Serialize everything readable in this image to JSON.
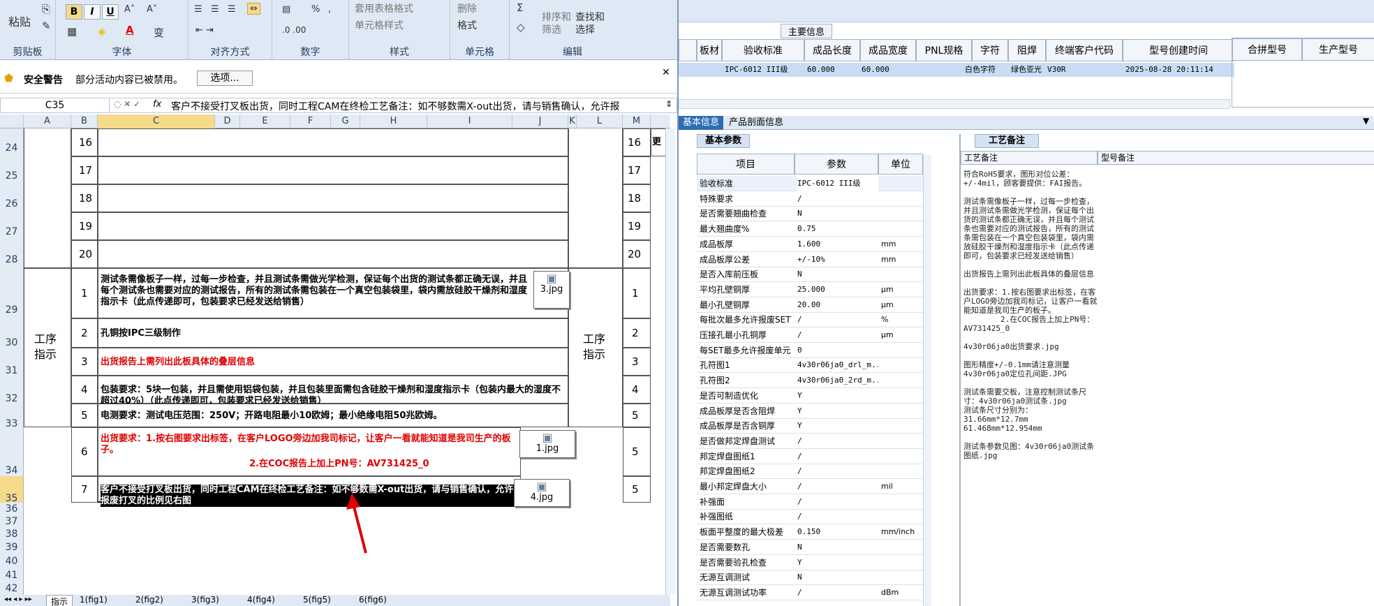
{
  "ribbon": {
    "paste": "粘贴",
    "clipboard": "剪贴板",
    "font": "字体",
    "alignment": "对齐方式",
    "number": "数字",
    "styles": "样式",
    "cells": "单元格",
    "editing": "编辑",
    "table_format": "套用表格格式",
    "cell_styles": "单元格样式",
    "delete": "删除",
    "format": "格式",
    "sort_filter": "排序和\n筛选",
    "find_select": "查找和\n选择",
    "bold": "B",
    "italic": "I",
    "underline": "U"
  },
  "alert": {
    "title": "安全警告",
    "message": "部分活动内容已被禁用。",
    "options_btn": "选项..."
  },
  "formula_bar": {
    "cell_ref": "C35",
    "fx": "fx",
    "content": "客户不接受打叉板出货，同时工程CAM在终检工艺备注：如不够数需X-out出货，请与销售确认，允许报"
  },
  "columns": [
    "A",
    "B",
    "C",
    "D",
    "E",
    "F",
    "G",
    "H",
    "I",
    "J",
    "K",
    "L",
    "M"
  ],
  "rows": [
    "24",
    "25",
    "26",
    "27",
    "28",
    "29",
    "30",
    "31",
    "32",
    "33",
    "34",
    "35",
    "36",
    "37",
    "38",
    "39",
    "40",
    "41",
    "42"
  ],
  "sheet": {
    "section_label": "工序\n指示",
    "num_rows": [
      "16",
      "17",
      "18",
      "19",
      "20"
    ],
    "right_truncated": "更",
    "steps": [
      {
        "n": "1",
        "text": "测试条需像板子一样，过每一步检查，并且测试条需做光学检测，保证每个出货的测试条都正确无误，并且每个测试条也需要对应的测试报告，所有的测试条需包装在一个真空包装袋里，袋内需放硅胶干燥剂和湿度指示卡（此点传递即可，包装要求已经发送给销售）",
        "red": false,
        "img": "3.jpg",
        "right": "1"
      },
      {
        "n": "2",
        "text": "孔铜按IPC三级制作",
        "red": false,
        "img": "",
        "right": "2"
      },
      {
        "n": "3",
        "text": "出货报告上需列出此板具体的叠层信息",
        "red": true,
        "img": "",
        "right": "3"
      },
      {
        "n": "4",
        "text": "包装要求：5块一包装，并且需使用铝袋包装，并且包装里面需包含硅胶干燥剂和湿度指示卡（包装内最大的湿度不超过40%）（此点传递即可，包装要求已经发送给销售）",
        "red": false,
        "img": "",
        "right": "4"
      },
      {
        "n": "5",
        "text": "电测要求：测试电压范围：250V；开路电阻最小10欧姆；最小绝缘电阻50兆欧姆。",
        "red": false,
        "img": "",
        "right": "5"
      },
      {
        "n": "6",
        "text": "出货要求：1.按右图要求出标签，在客户LOGO旁边加我司标记，让客户一看就能知道是我司生产的板子。",
        "text2": "2.在COC报告上加上PN号：AV731425_0",
        "red": true,
        "img": "1.jpg",
        "right": "5"
      },
      {
        "n": "7",
        "text": "客户不接受打叉板出货，同时工程CAM在终检工艺备注：如不够数需X-out出货，请与销售确认，允许报废打叉的比例见右图",
        "red": false,
        "img": "4.jpg",
        "right": "5"
      }
    ]
  },
  "sheet_tabs": [
    "指示",
    "1(fig1)",
    "2(fig2)",
    "3(fig3)",
    "4(fig4)",
    "5(fig5)",
    "6(fig6)"
  ],
  "right": {
    "section_title": "主要信息",
    "headers": [
      "板材",
      "验收标准",
      "成品长度",
      "成品宽度",
      "PNL规格",
      "字符",
      "阻焊",
      "终端客户代码",
      "型号创建时间",
      "合拼型号",
      "生产型号"
    ],
    "row": [
      "",
      "IPC-6012 III级",
      "60.000",
      "60.000",
      "",
      "白色字符",
      "绿色亚光",
      "V30R",
      "2025-08-28 20:11:14"
    ],
    "tabs": [
      "基本信息",
      "产品剖面信息"
    ],
    "subtab": "基本参数",
    "notes_tab": "工艺备注",
    "grid_headers": [
      "项目",
      "参数",
      "单位"
    ],
    "params": [
      [
        "验收标准",
        "IPC-6012 III级",
        ""
      ],
      [
        "特殊要求",
        "/",
        ""
      ],
      [
        "是否需要翘曲检查",
        "N",
        ""
      ],
      [
        "最大翘曲度%",
        "0.75",
        ""
      ],
      [
        "成品板厚",
        "1.600",
        "mm"
      ],
      [
        "成品板厚公差",
        "+/-10%",
        "mm"
      ],
      [
        "是否入库前压板",
        "N",
        ""
      ],
      [
        "平均孔壁铜厚",
        "25.000",
        "μm"
      ],
      [
        "最小孔壁铜厚",
        "20.00",
        "μm"
      ],
      [
        "每批次最多允许报废SET",
        "/",
        "%"
      ],
      [
        "压接孔最小孔铜厚",
        "/",
        "μm"
      ],
      [
        "每SET最多允许报废单元",
        "0",
        ""
      ],
      [
        "孔符图1",
        "4v30r06ja0_drl_m...",
        ""
      ],
      [
        "孔符图2",
        "4v30r06ja0_2rd_m...",
        ""
      ],
      [
        "是否可制造优化",
        "Y",
        ""
      ],
      [
        "成品板厚是否含阻焊",
        "Y",
        ""
      ],
      [
        "成品板厚是否含铜厚",
        "Y",
        ""
      ],
      [
        "是否做邦定焊盘测试",
        "/",
        ""
      ],
      [
        "邦定焊盘图纸1",
        "/",
        ""
      ],
      [
        "邦定焊盘图纸2",
        "/",
        ""
      ],
      [
        "最小邦定焊盘大小",
        "/",
        "mil"
      ],
      [
        "补强面",
        "/",
        ""
      ],
      [
        "补强图纸",
        "/",
        ""
      ],
      [
        "板面平整度的最大极差",
        "0.150",
        "mm/inch"
      ],
      [
        "是否需要数孔",
        "N",
        ""
      ],
      [
        "是否需要验孔检查",
        "Y",
        ""
      ],
      [
        "无源互调测试",
        "N",
        ""
      ],
      [
        "无源互调测试功率",
        "/",
        "dBm"
      ]
    ],
    "notes_header": [
      "工艺备注",
      "型号备注"
    ],
    "notes": "符合RoHS要求，图形对位公差：+/-4mil，顾客要提供：FAI报告。\n\n测试条需像板子一样，过每一步检查，并且测试条需做光学检测，保证每个出货的测试条都正确无误，并且每个测试条也需要对应的测试报告，所有的测试条需包装在一个真空包装袋里，袋内需放硅胶干燥剂和湿度指示卡（此点传递即可，包装要求已经发送给销售）\n\n出货报告上需列出此板具体的叠层信息\n\n出货要求：1.按右图要求出标签，在客户LOGO旁边加我司标记，让客户一看就能知道是我司生产的板子。\n        2.在COC报告上加上PN号：AV731425_0\n\n4v30r06ja0出货要求.jpg\n\n图形精度+/-0.1mm请注意测量\n4v30r06ja0定位孔间距.JPG\n\n测试条需要交板，注意控制测试条尺寸：4v30r06ja0测试条.jpg\n测试条尺寸分别为：\n31.66mm*12.7mm\n61.468mm*12.954mm\n\n测试条参数见图：4v30r06ja0测试条图纸.jpg",
    "y": "Y"
  },
  "colors": {
    "ribbon": "#dfe9f5",
    "accent": "#1f5fb0",
    "selected_row": "#c9dcf4",
    "red_text": "#e00000"
  }
}
